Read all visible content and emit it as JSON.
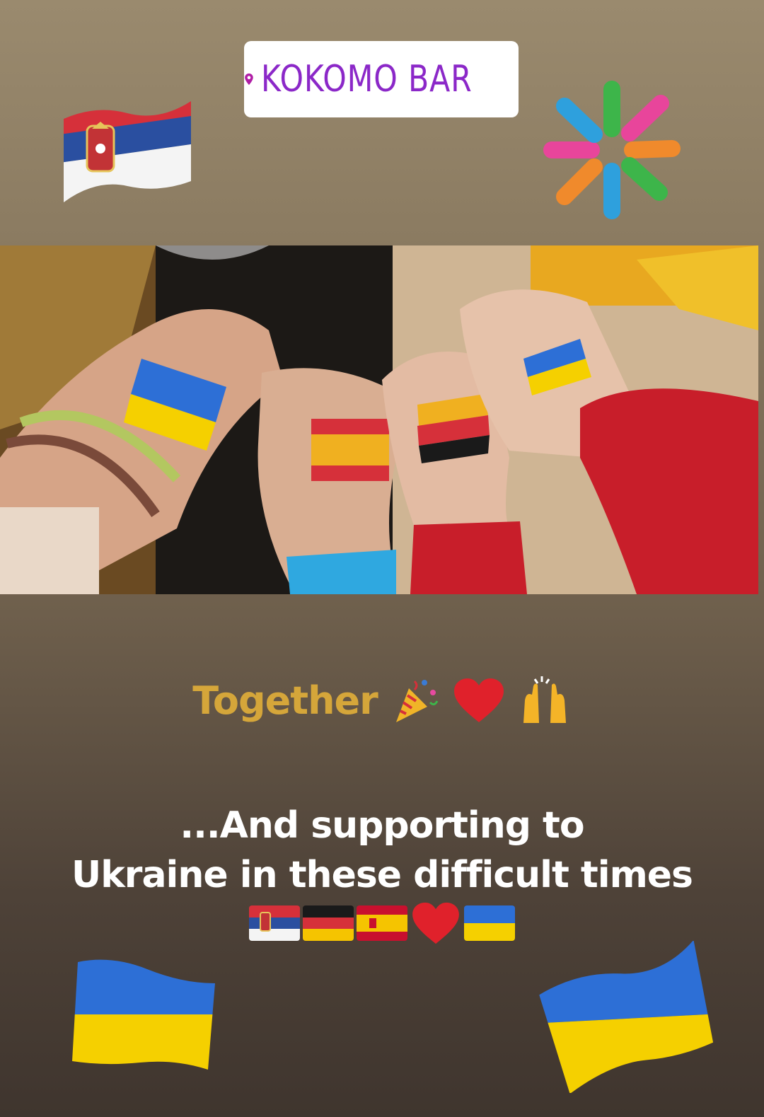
{
  "story": {
    "location_sticker": {
      "label": "KOKOMO BAR",
      "icon": "map-pin-icon",
      "color": "#8b28c8"
    },
    "top_left_flag": {
      "icon": "serbia-flag-icon"
    },
    "top_right_sticker": {
      "icon": "colorful-asterisk-icon"
    },
    "photo": {
      "description_icon": "painted-hands-photo"
    },
    "caption_together": {
      "text": "Together",
      "emojis": [
        "party-popper-icon",
        "red-heart-icon",
        "raising-hands-icon"
      ]
    },
    "caption_support": {
      "line1": "...And supporting to",
      "line2": "Ukraine in these difficult times"
    },
    "flag_row": [
      "serbia-flag-icon",
      "germany-flag-icon",
      "spain-flag-icon",
      "red-heart-icon",
      "ukraine-flag-icon"
    ],
    "bottom_left_flag": {
      "icon": "ukraine-flag-icon"
    },
    "bottom_right_flag": {
      "icon": "ukraine-flag-icon"
    },
    "colors": {
      "ukraine_blue": "#2d6fd6",
      "ukraine_yellow": "#f5d000",
      "serbia_red": "#d6303a",
      "serbia_blue": "#2a4fa0",
      "together_gold": "#d5a63a"
    }
  }
}
